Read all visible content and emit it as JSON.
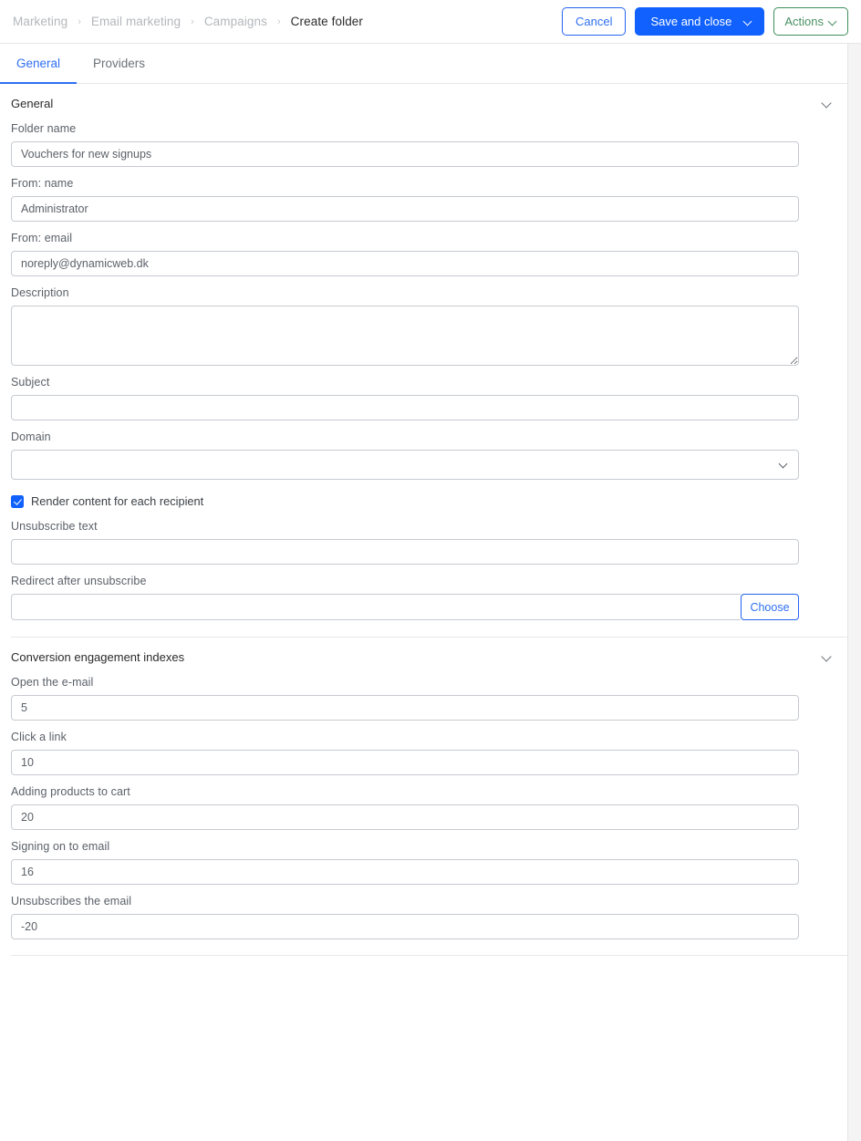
{
  "topbar": {
    "breadcrumb": [
      {
        "label": "Marketing",
        "current": false
      },
      {
        "label": "Email marketing",
        "current": false
      },
      {
        "label": "Campaigns",
        "current": false
      },
      {
        "label": "Create folder",
        "current": true
      }
    ],
    "separator": "›",
    "cancel_label": "Cancel",
    "save_label": "Save and close",
    "actions_label": "Actions"
  },
  "tabs": [
    {
      "label": "General",
      "active": true
    },
    {
      "label": "Providers",
      "active": false
    }
  ],
  "sections": {
    "general": {
      "title": "General",
      "fields": {
        "folder_name": {
          "label": "Folder name",
          "value": "Vouchers for new signups"
        },
        "from_name": {
          "label": "From: name",
          "value": "Administrator"
        },
        "from_email": {
          "label": "From: email",
          "value": "noreply@dynamicweb.dk"
        },
        "description": {
          "label": "Description",
          "value": ""
        },
        "subject": {
          "label": "Subject",
          "value": ""
        },
        "domain": {
          "label": "Domain",
          "value": "",
          "options": [
            ""
          ]
        },
        "render_content": {
          "label": "Render content for each recipient",
          "checked": true
        },
        "unsubscribe_text": {
          "label": "Unsubscribe text",
          "value": ""
        },
        "redirect_after_unsubscribe": {
          "label": "Redirect after unsubscribe",
          "value": "",
          "button_label": "Choose"
        }
      }
    },
    "conversion": {
      "title": "Conversion engagement indexes",
      "fields": {
        "open_email": {
          "label": "Open the e-mail",
          "value": "5"
        },
        "click_link": {
          "label": "Click a link",
          "value": "10"
        },
        "add_to_cart": {
          "label": "Adding products to cart",
          "value": "20"
        },
        "signing_on": {
          "label": "Signing on to email",
          "value": "16"
        },
        "unsubscribes": {
          "label": "Unsubscribes the email",
          "value": "-20"
        }
      }
    }
  },
  "colors": {
    "primary_blue": "#1161ff",
    "link_blue": "#2f6ff2",
    "action_green": "#4a9063",
    "border_gray": "#c6cad0",
    "label_gray": "#5a6068",
    "breadcrumb_gray": "#b4b7bb"
  }
}
